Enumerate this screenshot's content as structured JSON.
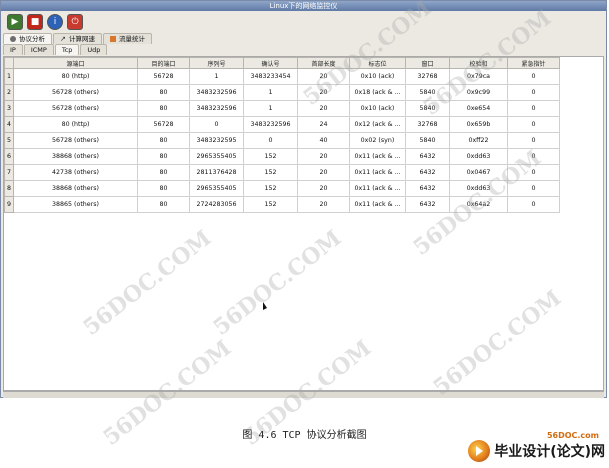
{
  "window": {
    "title": "Linux下的网络监控仪"
  },
  "toolbar": {
    "buttons": [
      "play-icon",
      "stop-icon",
      "info-icon",
      "power-icon"
    ]
  },
  "main_tabs": [
    {
      "label": "协议分析",
      "icon": "gear-icon",
      "active": true
    },
    {
      "label": "计算网速",
      "icon": "network-icon",
      "active": false
    },
    {
      "label": "流量统计",
      "icon": "stats-icon",
      "active": false
    }
  ],
  "protocol_tabs": [
    {
      "label": "IP",
      "active": false
    },
    {
      "label": "ICMP",
      "active": false
    },
    {
      "label": "Tcp",
      "active": true
    },
    {
      "label": "Udp",
      "active": false
    }
  ],
  "table": {
    "columns": [
      "源端口",
      "目的端口",
      "序列号",
      "确认号",
      "首部长度",
      "标志位",
      "窗口",
      "校验和",
      "紧急指针"
    ],
    "rows": [
      [
        "1",
        "80 (http)",
        "56728",
        "1",
        "3483233454",
        "20",
        "0x10 (ack)",
        "32768",
        "0x79ca",
        "0"
      ],
      [
        "2",
        "56728 (others)",
        "80",
        "3483232596",
        "1",
        "20",
        "0x18 (ack & ...",
        "5840",
        "0x9c99",
        "0"
      ],
      [
        "3",
        "56728 (others)",
        "80",
        "3483232596",
        "1",
        "20",
        "0x10 (ack)",
        "5840",
        "0xe654",
        "0"
      ],
      [
        "4",
        "80 (http)",
        "56728",
        "0",
        "3483232596",
        "24",
        "0x12 (ack & ...",
        "32768",
        "0x659b",
        "0"
      ],
      [
        "5",
        "56728 (others)",
        "80",
        "3483232595",
        "0",
        "40",
        "0x02 (syn)",
        "5840",
        "0xff22",
        "0"
      ],
      [
        "6",
        "38868 (others)",
        "80",
        "2965355405",
        "152",
        "20",
        "0x11 (ack & ...",
        "6432",
        "0xdd63",
        "0"
      ],
      [
        "7",
        "42738 (others)",
        "80",
        "2811376428",
        "152",
        "20",
        "0x11 (ack & ...",
        "6432",
        "0x0467",
        "0"
      ],
      [
        "8",
        "38868 (others)",
        "80",
        "2965355405",
        "152",
        "20",
        "0x11 (ack & ...",
        "6432",
        "0xdd63",
        "0"
      ],
      [
        "9",
        "38865 (others)",
        "80",
        "2724283056",
        "152",
        "20",
        "0x11 (ack & ...",
        "6432",
        "0x64a2",
        "0"
      ]
    ]
  },
  "caption": "图 4.6 TCP 协议分析截图",
  "watermark": "56DOC.COM",
  "brand": {
    "url": "56DOC.com",
    "text": "毕业设计(论文)网"
  }
}
